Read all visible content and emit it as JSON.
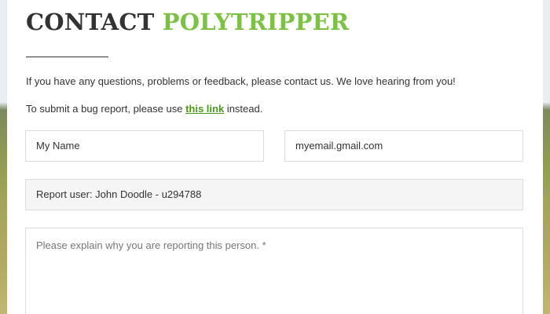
{
  "header": {
    "title_part1": "CONTACT",
    "title_part2": "POLYTRIPPER",
    "colors": {
      "title_dark": "#333333",
      "title_accent": "#7bc143",
      "link": "#4a9a1d"
    }
  },
  "intro": {
    "text": "If you have any questions, problems or feedback, please contact us. We love hearing from you!"
  },
  "bug_report": {
    "prefix": "To submit a bug report, please use ",
    "link_text": "this link",
    "suffix": " instead."
  },
  "form": {
    "name_value": "My Name",
    "email_value": "myemail.gmail.com",
    "report_value": "Report user: John Doodle - u294788",
    "message_placeholder": "Please explain why you are reporting this person. *"
  }
}
